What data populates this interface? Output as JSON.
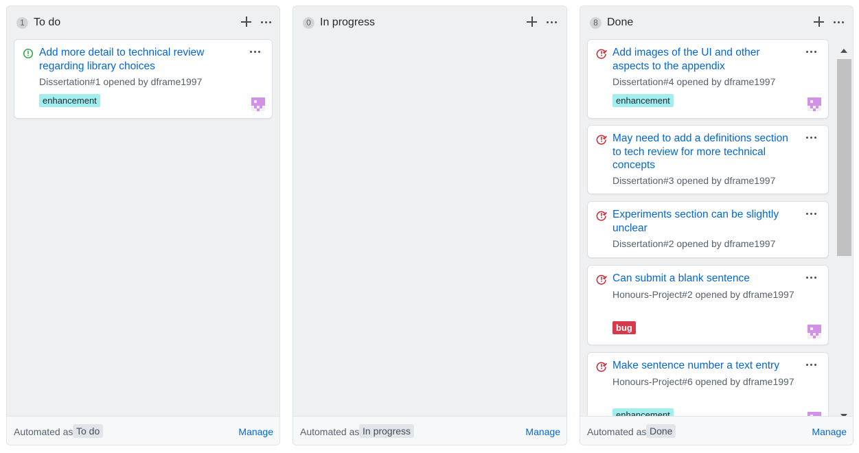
{
  "colors": {
    "link": "#0366d6",
    "open_icon": "#28a745",
    "closed_icon": "#cb2431",
    "enhancement_label": "#a2eeef",
    "bug_label": "#d73a4a",
    "avatar": "#d291e4"
  },
  "columns": [
    {
      "count": "1",
      "title": "To do",
      "automated_label": "Automated as",
      "automated_value": "To do",
      "manage": "Manage",
      "cards": [
        {
          "title": "Add more detail to technical review regarding library choices",
          "meta": "Dissertation#1 opened by dframe1997",
          "status_icon": "issue-opened-icon",
          "label": "enhancement"
        }
      ]
    },
    {
      "count": "0",
      "title": "In progress",
      "automated_label": "Automated as",
      "automated_value": "In progress",
      "manage": "Manage",
      "cards": []
    },
    {
      "count": "8",
      "title": "Done",
      "automated_label": "Automated as",
      "automated_value": "Done",
      "manage": "Manage",
      "cards": [
        {
          "title": "Add images of the UI and other aspects to the appendix",
          "meta": "Dissertation#4 opened by dframe1997",
          "status_icon": "issue-closed-icon",
          "label": "enhancement"
        },
        {
          "title": "May need to add a definitions section to tech review for more technical concepts",
          "meta": "Dissertation#3 opened by dframe1997",
          "status_icon": "issue-closed-icon"
        },
        {
          "title": "Experiments section can be slightly unclear",
          "meta": "Dissertation#2 opened by dframe1997",
          "status_icon": "issue-closed-icon"
        },
        {
          "title": "Can submit a blank sentence",
          "meta": "Honours-Project#2 opened by dframe1997",
          "status_icon": "issue-closed-icon",
          "label": "bug"
        },
        {
          "title": "Make sentence number a text entry",
          "meta": "Honours-Project#6 opened by dframe1997",
          "status_icon": "issue-closed-icon",
          "label": "enhancement"
        }
      ]
    }
  ]
}
